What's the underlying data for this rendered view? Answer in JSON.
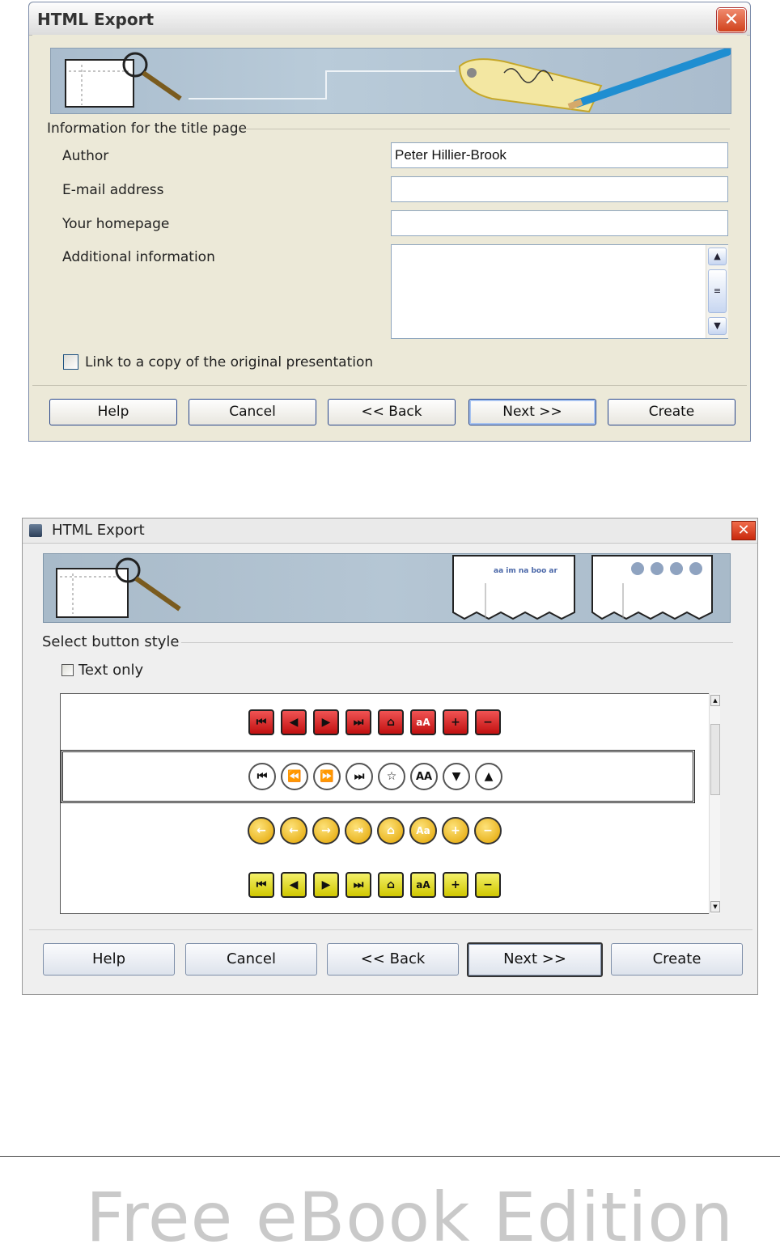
{
  "dialog1": {
    "title": "HTML Export",
    "section_label": "Information for the title page",
    "fields": {
      "author_label": "Author",
      "author_value": "Peter Hillier-Brook",
      "email_label": "E-mail address",
      "email_value": "",
      "homepage_label": "Your homepage",
      "homepage_value": "",
      "info_label": "Additional information",
      "info_value": ""
    },
    "checkbox_label": "Link to a copy of the original presentation",
    "checkbox_checked": false,
    "buttons": {
      "help": "Help",
      "cancel": "Cancel",
      "back": "<< Back",
      "next": "Next >>",
      "create": "Create"
    }
  },
  "dialog2": {
    "title": "HTML Export",
    "banner_preview_text": "aa im na boo ar",
    "section_label": "Select button style",
    "text_only_label": "Text only",
    "text_only_checked": false,
    "button_styles": [
      {
        "style": "red-square",
        "icons": [
          "first-icon",
          "prev-icon",
          "next-icon",
          "last-icon",
          "home-icon",
          "aA",
          "plus-icon",
          "minus-icon"
        ]
      },
      {
        "style": "white-round",
        "selected": true,
        "icons": [
          "first-icon",
          "rewind-icon",
          "forward-icon",
          "last-icon",
          "star-icon",
          "AA",
          "down-icon",
          "up-icon"
        ]
      },
      {
        "style": "gold-round",
        "icons": [
          "left-arrow-icon",
          "left-arrow-icon",
          "right-arrow-icon",
          "last-icon",
          "home-icon",
          "Aa",
          "plus-icon",
          "minus-icon"
        ]
      },
      {
        "style": "yellow-square",
        "icons": [
          "first-icon",
          "prev-icon",
          "next-icon",
          "last-icon",
          "home-icon",
          "aA",
          "plus-icon",
          "minus-icon"
        ]
      }
    ],
    "buttons": {
      "help": "Help",
      "cancel": "Cancel",
      "back": "<< Back",
      "next": "Next >>",
      "create": "Create"
    }
  },
  "footer": "Free eBook Edition"
}
